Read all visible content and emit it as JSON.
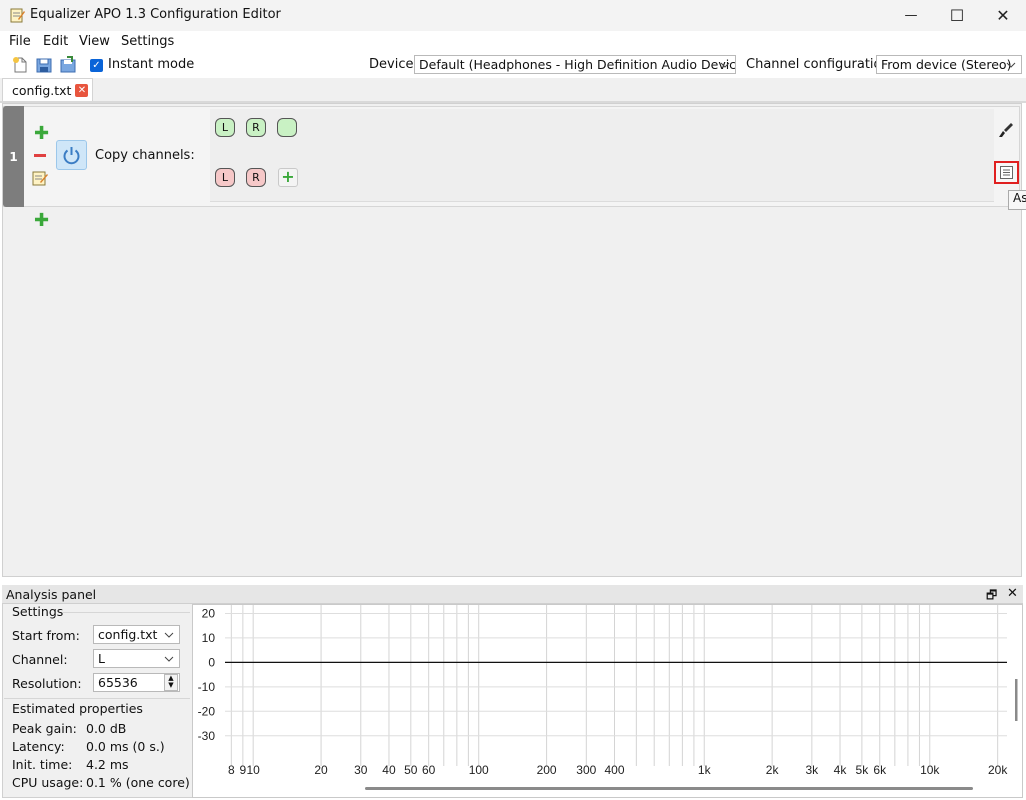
{
  "window": {
    "title": "Equalizer APO 1.3 Configuration Editor",
    "controls": {
      "minimize": "—",
      "maximize": "☐",
      "close": "✕"
    }
  },
  "menu": [
    "File",
    "Edit",
    "View",
    "Settings"
  ],
  "toolbar": {
    "instant_mode_label": "Instant mode",
    "instant_mode_checked": true,
    "device_label": "Device:",
    "device_value": "Default (Headphones - High Definition Audio Device)",
    "channel_config_label": "Channel configuration:",
    "channel_config_value": "From device (Stereo)"
  },
  "tabs": [
    {
      "label": "config.txt",
      "active": true
    }
  ],
  "filters": [
    {
      "index": "1",
      "name": "Copy channels:",
      "enabled": true,
      "target_channels": [
        "L",
        "R",
        ""
      ],
      "source_channels": [
        "L",
        "R"
      ]
    }
  ],
  "tooltip_fragment": "As",
  "analysis": {
    "title": "Analysis panel",
    "settings_header": "Settings",
    "start_from_label": "Start from:",
    "start_from_value": "config.txt",
    "channel_label": "Channel:",
    "channel_value": "L",
    "resolution_label": "Resolution:",
    "resolution_value": "65536",
    "estimated_header": "Estimated properties",
    "peak_gain_label": "Peak gain:",
    "peak_gain_value": "0.0 dB",
    "latency_label": "Latency:",
    "latency_value": "0.0 ms (0 s.)",
    "init_time_label": "Init. time:",
    "init_time_value": "4.2 ms",
    "cpu_usage_label": "CPU usage:",
    "cpu_usage_value": "0.1 % (one core)"
  },
  "chart_data": {
    "type": "line",
    "title": "",
    "xlabel": "",
    "ylabel": "",
    "x_scale": "log",
    "xlim": [
      7.5,
      22000
    ],
    "ylim": [
      -35,
      21
    ],
    "y_ticks": [
      20,
      10,
      0,
      -10,
      -20,
      -30
    ],
    "x_ticks": [
      {
        "value": 8,
        "label": "8"
      },
      {
        "value": 9,
        "label": "9"
      },
      {
        "value": 10,
        "label": "10"
      },
      {
        "value": 20,
        "label": "20"
      },
      {
        "value": 30,
        "label": "30"
      },
      {
        "value": 40,
        "label": "40"
      },
      {
        "value": 50,
        "label": "50"
      },
      {
        "value": 60,
        "label": "60"
      },
      {
        "value": 100,
        "label": "100"
      },
      {
        "value": 200,
        "label": "200"
      },
      {
        "value": 300,
        "label": "300"
      },
      {
        "value": 400,
        "label": "400"
      },
      {
        "value": 1000,
        "label": "1k"
      },
      {
        "value": 2000,
        "label": "2k"
      },
      {
        "value": 3000,
        "label": "3k"
      },
      {
        "value": 4000,
        "label": "4k"
      },
      {
        "value": 5000,
        "label": "5k"
      },
      {
        "value": 6000,
        "label": "6k"
      },
      {
        "value": 10000,
        "label": "10k"
      },
      {
        "value": 20000,
        "label": "20k"
      }
    ],
    "grid_x": [
      8,
      9,
      10,
      20,
      30,
      40,
      50,
      60,
      70,
      80,
      90,
      100,
      200,
      300,
      400,
      500,
      600,
      700,
      800,
      900,
      1000,
      2000,
      3000,
      4000,
      5000,
      6000,
      7000,
      8000,
      9000,
      10000,
      20000
    ],
    "series": [
      {
        "x": [
          7.5,
          22000
        ],
        "y": [
          0,
          0
        ]
      }
    ],
    "grid": true,
    "legend": "none"
  }
}
